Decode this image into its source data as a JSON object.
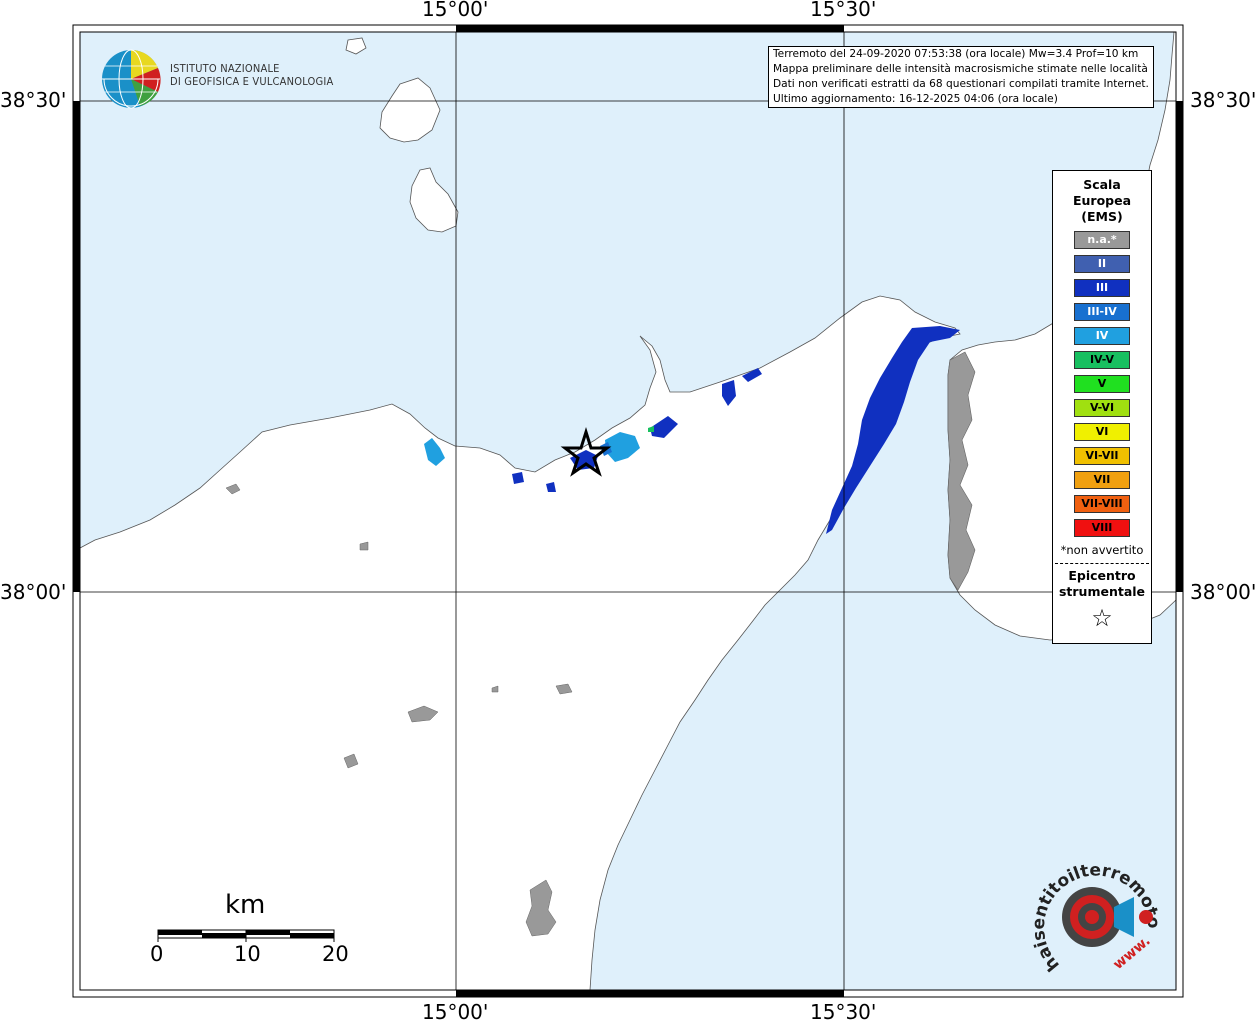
{
  "map": {
    "lon_labels": {
      "a": "15°00'",
      "b": "15°30'"
    },
    "lat_labels": {
      "a": "38°30'",
      "b": "38°00'"
    }
  },
  "info_box": {
    "lines": [
      "Terremoto del 24-09-2020 07:53:38 (ora locale) Mw=3.4 Prof=10 km",
      "Mappa preliminare delle intensità macrosismiche stimate nelle località",
      "Dati non verificati estratti da 68 questionari compilati tramite Internet.",
      "Ultimo aggiornamento: 16-12-2025 04:06 (ora locale)"
    ]
  },
  "logo": {
    "institute_line1": "ISTITUTO NAZIONALE",
    "institute_line2": "DI GEOFISICA E VULCANOLOGIA"
  },
  "legend": {
    "title_line1": "Scala",
    "title_line2": "Europea",
    "title_line3": "(EMS)",
    "items": [
      {
        "label": "n.a.*",
        "color": "#999999",
        "text_color": "#ffffff"
      },
      {
        "label": "II",
        "color": "#4060b0",
        "text_color": "#ffffff"
      },
      {
        "label": "III",
        "color": "#1030c0",
        "text_color": "#ffffff"
      },
      {
        "label": "III-IV",
        "color": "#1870d0",
        "text_color": "#ffffff"
      },
      {
        "label": "IV",
        "color": "#20a0e0",
        "text_color": "#ffffff"
      },
      {
        "label": "IV-V",
        "color": "#18c060",
        "text_color": "#000000"
      },
      {
        "label": "V",
        "color": "#20e020",
        "text_color": "#000000"
      },
      {
        "label": "V-VI",
        "color": "#a0e010",
        "text_color": "#000000"
      },
      {
        "label": "VI",
        "color": "#f0f000",
        "text_color": "#000000"
      },
      {
        "label": "VI-VII",
        "color": "#f0c000",
        "text_color": "#000000"
      },
      {
        "label": "VII",
        "color": "#f0a010",
        "text_color": "#000000"
      },
      {
        "label": "VII-VIII",
        "color": "#f06010",
        "text_color": "#000000"
      },
      {
        "label": "VIII",
        "color": "#f01010",
        "text_color": "#000000"
      }
    ],
    "note": "*non avvertito",
    "epicenter_line1": "Epicentro",
    "epicenter_line2": "strumentale",
    "epicenter_symbol": "☆"
  },
  "scale_bar": {
    "unit": "km",
    "ticks": [
      "0",
      "10",
      "20"
    ]
  },
  "hsit_logo": {
    "text": "haisentitoilterremoto.it",
    "url_text": "www."
  },
  "colors": {
    "sea": "#dff0fb",
    "land": "#ffffff",
    "grid": "#000000"
  }
}
